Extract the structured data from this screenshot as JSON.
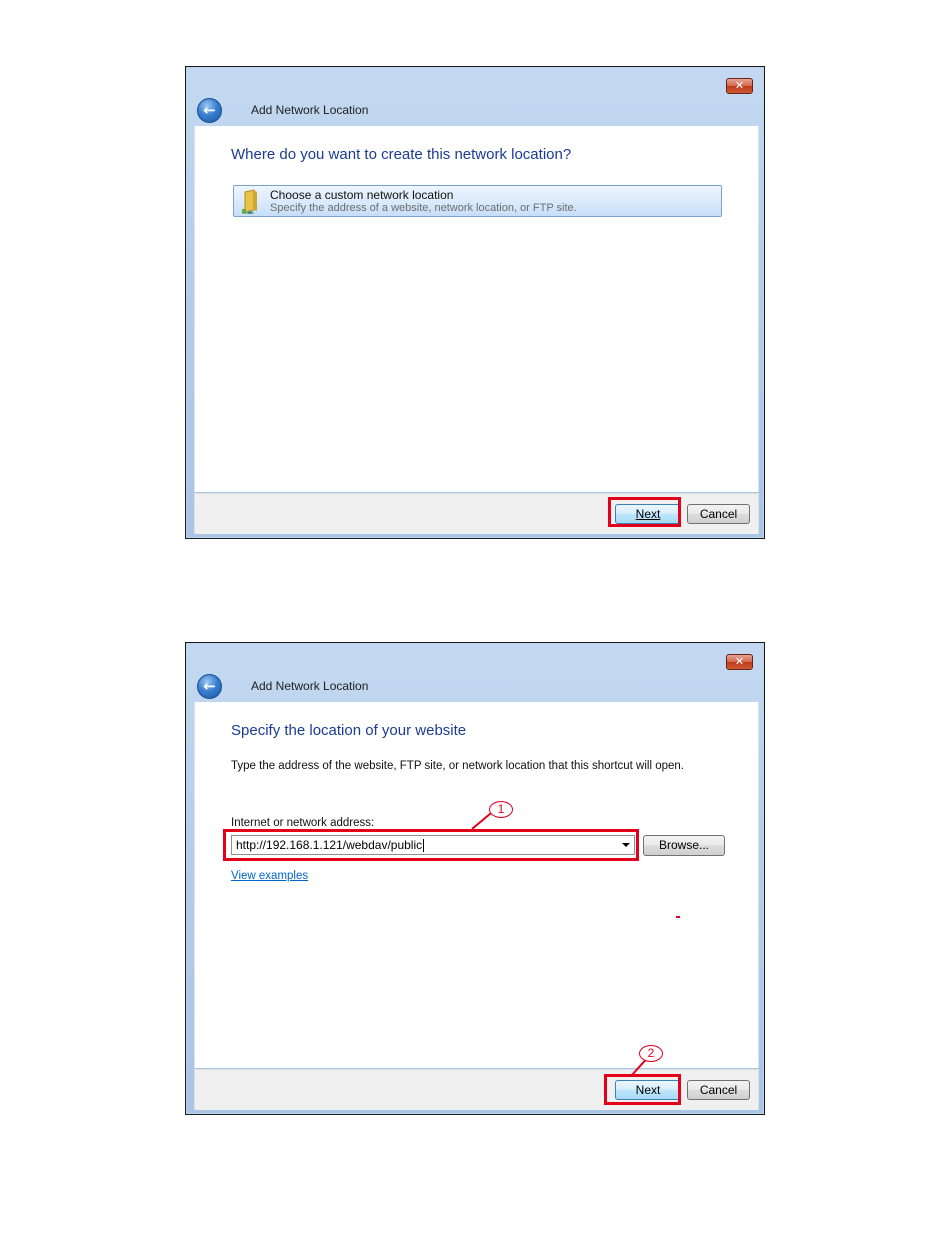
{
  "windows": [
    {
      "title": "Add Network Location",
      "close_glyph": "✕",
      "back_icon": "back-arrow-icon",
      "heading": "Where do you want to create this network location?",
      "option": {
        "icon": "network-folder-icon",
        "title": "Choose a custom network location",
        "description": "Specify the address of a website, network location, or FTP site."
      },
      "buttons": {
        "next": "Next",
        "cancel": "Cancel"
      }
    },
    {
      "title": "Add Network Location",
      "close_glyph": "✕",
      "back_icon": "back-arrow-icon",
      "heading": "Specify the location of your website",
      "description": "Type the address of the website, FTP site, or network location that this shortcut will open.",
      "field_label": "Internet or network address:",
      "address_value": "http://192.168.1.121/webdav/public",
      "browse_label": "Browse...",
      "view_examples": "View examples",
      "buttons": {
        "next": "Next",
        "cancel": "Cancel"
      }
    }
  ],
  "annotations": {
    "color": "#e3001b",
    "callouts": [
      "1",
      "2"
    ]
  }
}
